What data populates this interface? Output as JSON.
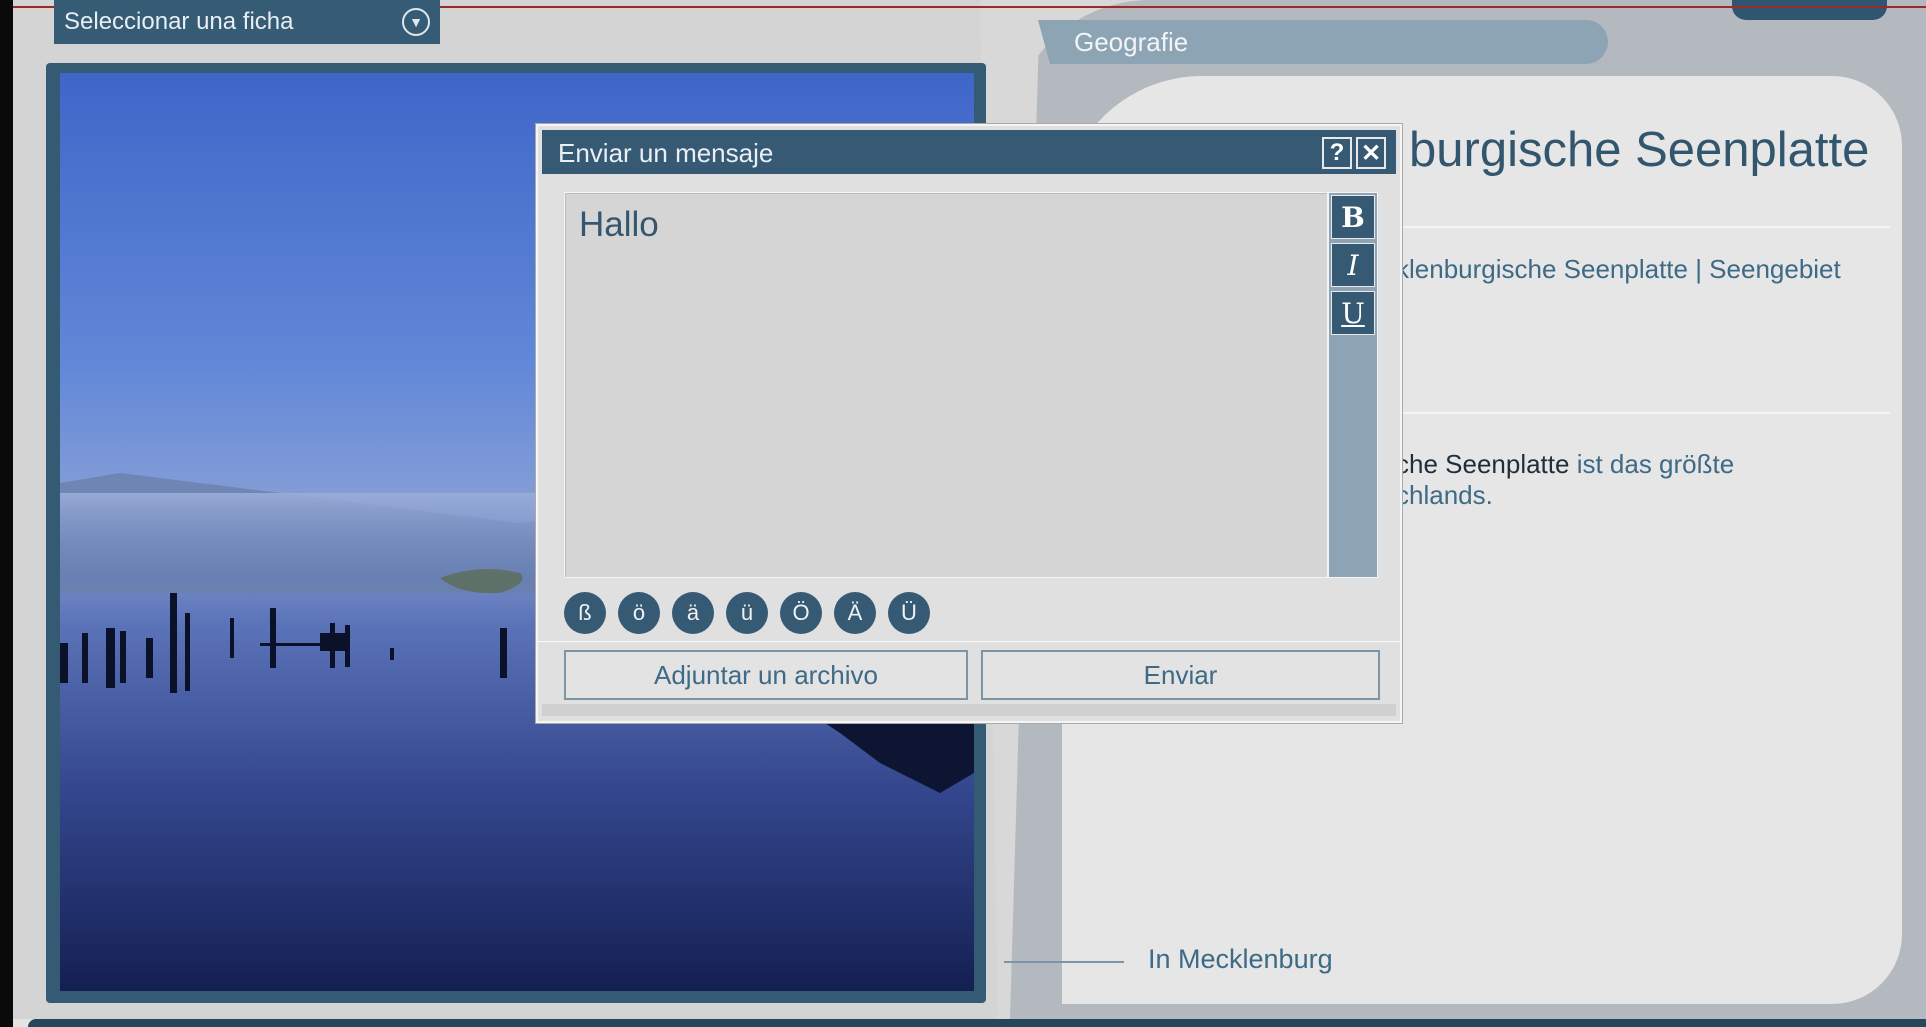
{
  "left_panel": {
    "select_label": "Seleccionar una ficha",
    "select_icon": "chevron-down-icon",
    "photo_alt": "lake"
  },
  "right_panel": {
    "tab_label": "Geografie",
    "title": "burgische Seenplatte",
    "keywords": "cklenburgische Seenplatte | Seengebiet",
    "description_dark": "sche Seenplatte",
    "description_rest": " ist das größte",
    "description_line2": "schlands.",
    "caption": "In Mecklenburg"
  },
  "dialog": {
    "title": "Enviar un mensaje",
    "help_label": "?",
    "close_label": "✕",
    "message_text": "Hallo",
    "format": {
      "bold_label": "B",
      "italic_label": "I",
      "underline_label": "U"
    },
    "special_chars": [
      "ß",
      "ö",
      "ä",
      "ü",
      "Ö",
      "Ä",
      "Ü"
    ],
    "attach_label": "Adjuntar un archivo",
    "send_label": "Enviar"
  },
  "colors": {
    "primary": "#365a73",
    "accent_text": "#3d6a86",
    "page_bg": "#e4e4e4"
  }
}
